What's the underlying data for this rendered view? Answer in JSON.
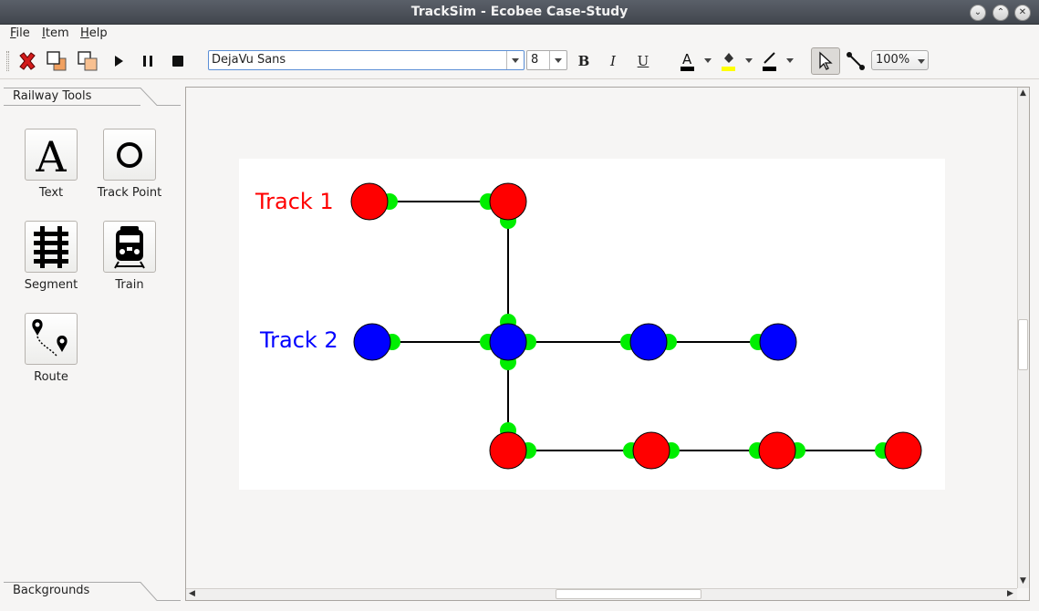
{
  "window": {
    "title": "TrackSim - Ecobee Case-Study",
    "controls": [
      "minimize-icon",
      "maximize-icon",
      "close-icon"
    ]
  },
  "menu": [
    {
      "label": "File",
      "mnemonic": "F",
      "rest": "ile"
    },
    {
      "label": "Item",
      "mnemonic": "I",
      "rest": "tem"
    },
    {
      "label": "Help",
      "mnemonic": "H",
      "rest": "elp"
    }
  ],
  "toolbar": {
    "font_family": "DejaVu Sans",
    "font_size": "8",
    "bold_label": "B",
    "italic_label": "I",
    "underline_label": "U",
    "zoom": "100%",
    "text_color": "#000000",
    "fill_color": "#ffff00",
    "line_color": "#000000",
    "icons": [
      "delete-icon",
      "bring-to-front-icon",
      "send-to-back-icon",
      "play-icon",
      "pause-icon",
      "stop-icon",
      "text-color-icon",
      "fill-color-icon",
      "line-color-icon",
      "pointer-icon",
      "connector-icon"
    ]
  },
  "left_panel": {
    "tab_label": "Railway Tools",
    "bottom_tab_label": "Backgrounds",
    "tools": [
      {
        "label": "Text",
        "icon": "text-tool-icon"
      },
      {
        "label": "Track Point",
        "icon": "track-point-icon"
      },
      {
        "label": "Segment",
        "icon": "segment-icon"
      },
      {
        "label": "Train",
        "icon": "train-icon"
      },
      {
        "label": "Route",
        "icon": "route-icon"
      }
    ]
  },
  "scene": {
    "labels": [
      {
        "text": "Track 1",
        "color": "#ff0000"
      },
      {
        "text": "Track 2",
        "color": "#0000ff"
      }
    ],
    "colors": {
      "red": "#ff0000",
      "blue": "#0000ff",
      "connector": "#00ee00"
    }
  }
}
